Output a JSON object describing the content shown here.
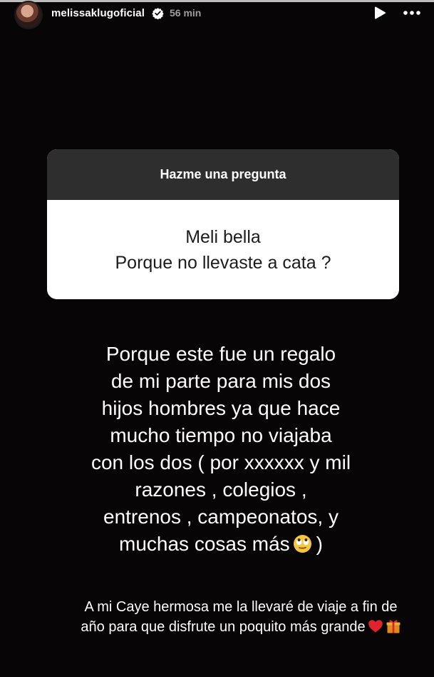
{
  "header": {
    "username": "melissaklugoficial",
    "time_ago": "56 min",
    "verified": true,
    "icons": [
      "avatar",
      "verified-badge-icon",
      "play-icon",
      "more-icon"
    ]
  },
  "story_progress": 1.0,
  "question_sticker": {
    "prompt": "Hazme una pregunta",
    "question_lines": [
      "Meli bella",
      "Porque no llevaste a cata ?"
    ]
  },
  "answer": {
    "lines": [
      "Porque  este fue un regalo",
      "de mi parte  para mis dos",
      "hijos hombres ya que hace",
      "mucho tiempo no viajaba",
      "con los dos ( por xxxxxx y mil",
      "razones ,  colegios ,",
      "entrenos , campeonatos, y",
      "muchas cosas más"
    ],
    "last_line_end": ")",
    "emoji": "eye-roll-face"
  },
  "footer_note": {
    "lines": [
      "A mi Caye hermosa me la llevaré de viaje a fin de",
      "año para que disfrute  un poquito más grande"
    ],
    "emojis": [
      "red-heart",
      "gift"
    ]
  },
  "colors": {
    "background": "#070505",
    "sticker_header": "#2e2e2e",
    "sticker_body": "#ffffff",
    "text_light": "#ffffff",
    "text_dark": "#1c1c1c",
    "timestamp": "#9e9e9e"
  }
}
